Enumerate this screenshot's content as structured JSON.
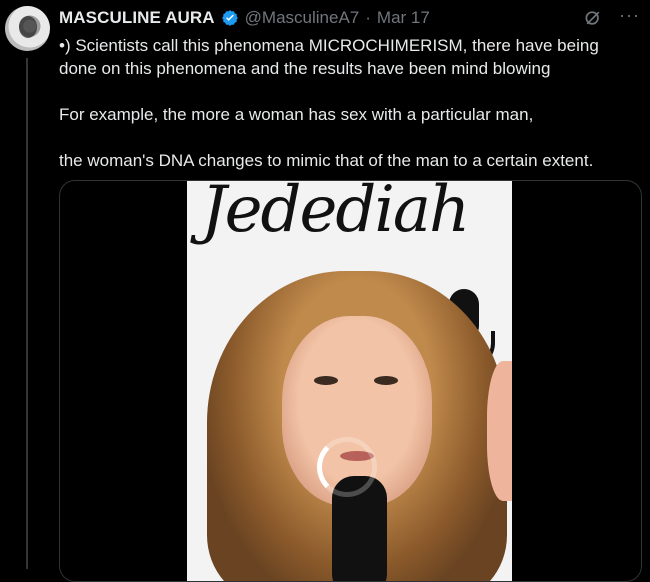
{
  "tweet": {
    "author_name": "MASCULINE AURA",
    "handle": "@MasculineA7",
    "separator": "·",
    "date": "Mar 17",
    "paragraphs": [
      "•) Scientists call this phenomena MICROCHIMERISM, there have being done on this phenomena and the results have been mind blowing",
      "For example, the more a woman has sex with a particular man,",
      "the woman's DNA changes to mimic that of the man to a certain extent."
    ]
  },
  "media": {
    "type": "video",
    "state": "loading",
    "background_text": "Jedediah"
  },
  "icons": {
    "verified": "verified-badge-icon",
    "grok": "grok-icon",
    "more": "more-options-icon",
    "loading": "loading-spinner-icon"
  },
  "colors": {
    "background": "#000000",
    "text": "#e7e9ea",
    "secondary_text": "#71767b",
    "verified": "#1d9bf0",
    "border": "#2f3336"
  }
}
